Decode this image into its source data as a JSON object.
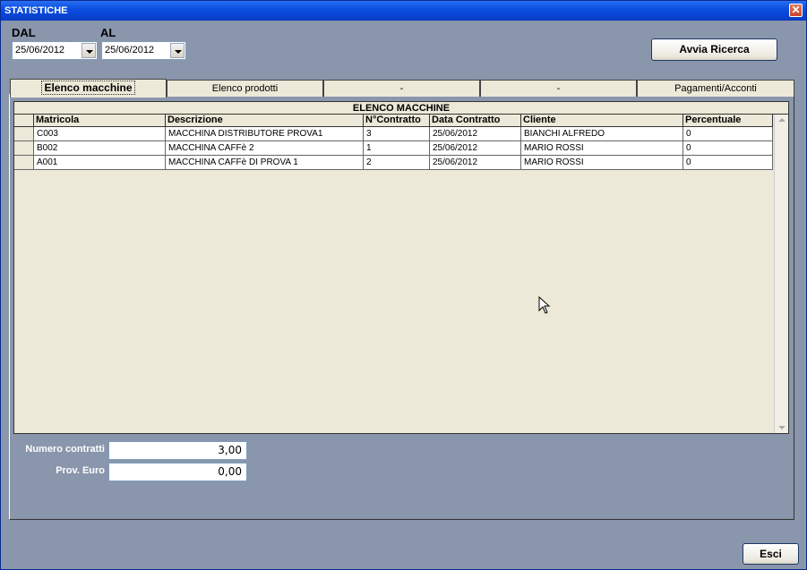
{
  "window": {
    "title": "STATISTICHE",
    "close_glyph": "✕"
  },
  "filters": {
    "dal_label": "DAL",
    "al_label": "AL",
    "dal_value": "25/06/2012",
    "al_value": "25/06/2012"
  },
  "search_button": "Avvia Ricerca",
  "tabs": [
    {
      "label": "Elenco macchine",
      "active": true
    },
    {
      "label": "Elenco prodotti",
      "active": false
    },
    {
      "label": "-",
      "active": false
    },
    {
      "label": "-",
      "active": false
    },
    {
      "label": "Pagamenti/Acconti",
      "active": false
    }
  ],
  "grid": {
    "caption": "ELENCO MACCHINE",
    "columns": [
      "Matricola",
      "Descrizione",
      "N°Contratto",
      "Data Contratto",
      "Cliente",
      "Percentuale"
    ],
    "rows": [
      [
        "C003",
        "MACCHINA DISTRIBUTORE PROVA1",
        "3",
        "25/06/2012",
        "BIANCHI ALFREDO",
        "0"
      ],
      [
        "B002",
        "MACCHINA CAFFè 2",
        "1",
        "25/06/2012",
        "MARIO ROSSI",
        "0"
      ],
      [
        "A001",
        "MACCHINA CAFFè DI PROVA 1",
        "2",
        "25/06/2012",
        "MARIO ROSSI",
        "0"
      ]
    ]
  },
  "summary": {
    "contracts_label": "Numero contratti",
    "contracts_value": "3,00",
    "prov_label": "Prov. Euro",
    "prov_value": "0,00"
  },
  "exit_button": "Esci",
  "icons": {
    "close": "close-icon",
    "dropdown": "chevron-down-icon",
    "cursor": "mouse-pointer-icon"
  }
}
